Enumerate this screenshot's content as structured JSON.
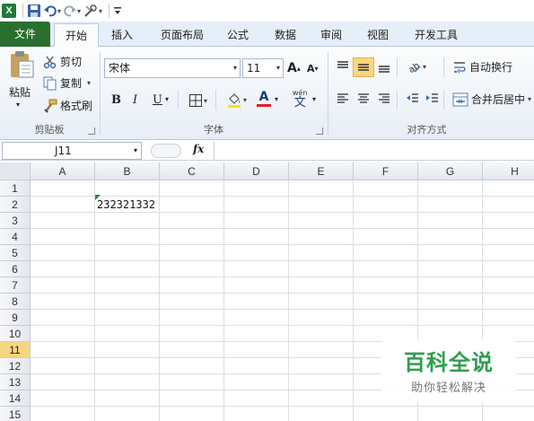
{
  "quick_access": {
    "app_icon": "excel-icon",
    "app_letter": "X",
    "icons": [
      "save-icon",
      "undo-icon",
      "redo-icon",
      "customize-icon",
      "qat-menu-icon"
    ]
  },
  "tabs": [
    "文件",
    "开始",
    "插入",
    "页面布局",
    "公式",
    "数据",
    "审阅",
    "视图",
    "开发工具"
  ],
  "active_tab": "开始",
  "clipboard": {
    "paste": "粘贴",
    "cut": "剪切",
    "copy": "复制",
    "format_painter": "格式刷",
    "group": "剪贴板"
  },
  "font": {
    "name": "宋体",
    "size": "11",
    "bold": "B",
    "italic": "I",
    "underline": "U",
    "font_color_letter": "A",
    "phonetic": "wén",
    "phonetic_char": "文",
    "group": "字体"
  },
  "alignment": {
    "wrap_text": "自动换行",
    "merge_center": "合并后居中",
    "group": "对齐方式"
  },
  "formula_bar": {
    "name_box": "J11",
    "fx": "fx",
    "value": ""
  },
  "grid": {
    "columns": [
      "A",
      "B",
      "C",
      "D",
      "E",
      "F",
      "G",
      "H"
    ],
    "rows": [
      "1",
      "2",
      "3",
      "4",
      "5",
      "6",
      "7",
      "8",
      "9",
      "10",
      "11",
      "12",
      "13",
      "14",
      "15"
    ],
    "selected_row": "11",
    "cells": {
      "B2": "232321332"
    }
  },
  "watermark": {
    "title": "百科全说",
    "subtitle": "助你轻松解决"
  },
  "colors": {
    "file_tab": "#2a6f2f",
    "selected_header": "#f7d680",
    "font_color_bar": "#e02020",
    "watermark": "#2f9e4d"
  }
}
